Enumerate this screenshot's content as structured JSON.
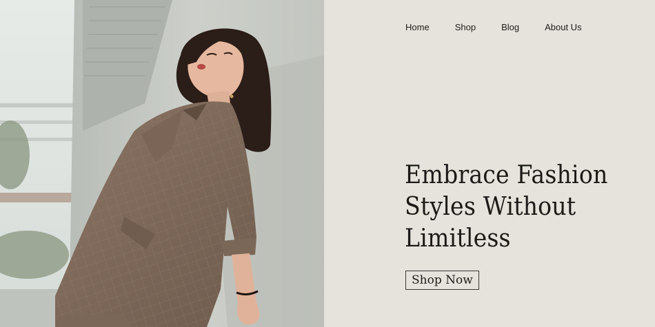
{
  "nav": {
    "items": [
      {
        "label": "Home"
      },
      {
        "label": "Shop"
      },
      {
        "label": "Blog"
      },
      {
        "label": "About Us"
      }
    ]
  },
  "hero": {
    "headline_lines": [
      "Embrace Fashion",
      "Styles Without",
      "Limitless"
    ],
    "cta_label": "Shop Now"
  },
  "colors": {
    "panel_background": "#e6e2dc",
    "text": "#1b1a17",
    "button_border": "#3b3a36",
    "blazer": "#7e6a5b",
    "wall": "#c9ccc6"
  },
  "icons": {
    "hero_image": "model-photo"
  }
}
